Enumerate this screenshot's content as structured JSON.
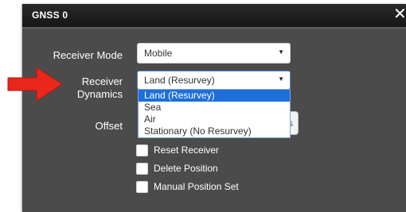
{
  "dialog": {
    "title": "GNSS 0",
    "close_glyph": "✕"
  },
  "form": {
    "receiver_mode": {
      "label": "Receiver Mode",
      "value": "Mobile"
    },
    "receiver_dynamics": {
      "label_line1": "Receiver",
      "label_line2": "Dynamics",
      "value": "Land (Resurvey)",
      "options": [
        "Land (Resurvey)",
        "Sea",
        "Air",
        "Stationary (No Resurvey)"
      ],
      "selected_option": "Land (Resurvey)"
    },
    "offset": {
      "label": "Offset",
      "partial_text": "s"
    },
    "checkboxes": [
      {
        "label": "Reset Receiver",
        "checked": false
      },
      {
        "label": "Delete Position",
        "checked": false
      },
      {
        "label": "Manual Position Set",
        "checked": false
      }
    ]
  },
  "colors": {
    "arrow": "#e8271d",
    "dialog_bg": "#4b4b4b",
    "titlebar_bg": "#1e1e1e",
    "highlight": "#1e6fd9"
  },
  "icons": {
    "caret": "▼",
    "arrow": "red-arrow-icon"
  }
}
